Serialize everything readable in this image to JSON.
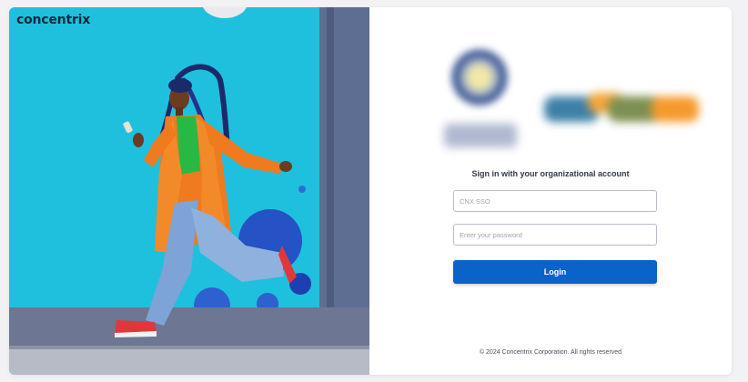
{
  "brand": {
    "name": "concentrix"
  },
  "login": {
    "heading": "Sign in with your organizational account",
    "username_placeholder": "CNX SSO",
    "username_value": "",
    "password_placeholder": "Enter your password",
    "password_value": "",
    "login_label": "Login",
    "footer": "© 2024 Concentrix Corporation. All rights reserved"
  },
  "colors": {
    "accent": "#0b63c9",
    "hero_background": "#1fc0dd",
    "brand_text": "#0b2a3c"
  },
  "icons": {
    "partner_logo_left": "blurred-circular-seal-logo",
    "partner_logo_right": "blurred-wordmark-logo"
  }
}
